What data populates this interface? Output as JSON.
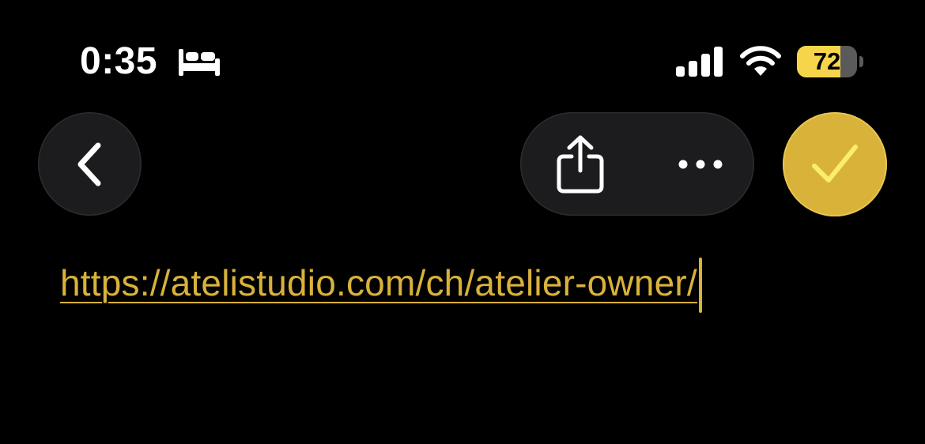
{
  "status_bar": {
    "time": "0:35",
    "battery_percent": "72",
    "battery_level": 0.72,
    "icons": [
      "sleep-focus-icon",
      "cellular-signal-icon",
      "wifi-icon",
      "battery-icon"
    ]
  },
  "toolbar": {
    "back_icon": "chevron-left-icon",
    "share_icon": "share-icon",
    "more_icon": "ellipsis-icon",
    "done_icon": "checkmark-icon"
  },
  "editor": {
    "url": "https://atelistudio.com/ch/atelier-owner/"
  },
  "colors": {
    "background": "#000000",
    "accent": "#d9b23a",
    "battery_fill": "#f7d54a",
    "button_bg": "#1c1c1e",
    "text": "#ffffff"
  }
}
